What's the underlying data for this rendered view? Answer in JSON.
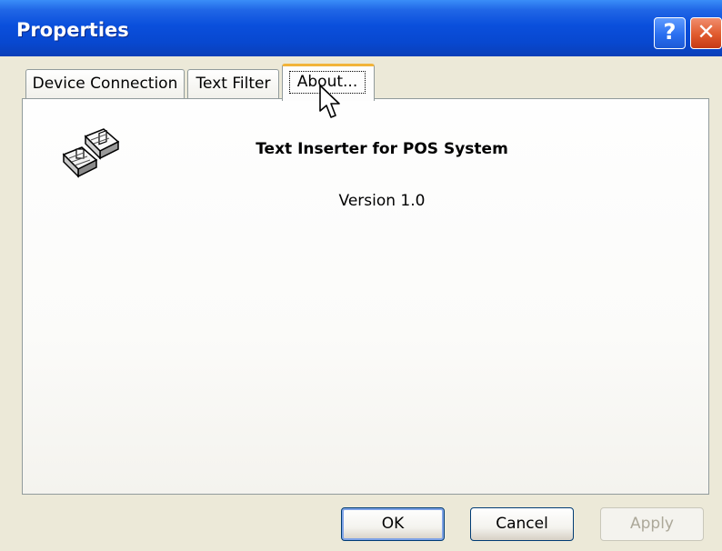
{
  "window": {
    "title": "Properties"
  },
  "title_buttons": {
    "help": "?",
    "close": "✕"
  },
  "tabs": [
    {
      "label": "Device Connection",
      "active": false
    },
    {
      "label": "Text Filter",
      "active": false
    },
    {
      "label": "About...",
      "active": true
    }
  ],
  "about": {
    "app_name": "Text Inserter for POS System",
    "version": "Version 1.0",
    "icon": "pos-keyboard-icon"
  },
  "buttons": {
    "ok": "OK",
    "cancel": "Cancel",
    "apply": "Apply"
  },
  "colors": {
    "titlebar": "#0a4fdc",
    "active_tab_accent": "#f2b43a",
    "window_bg": "#ece9d8"
  }
}
